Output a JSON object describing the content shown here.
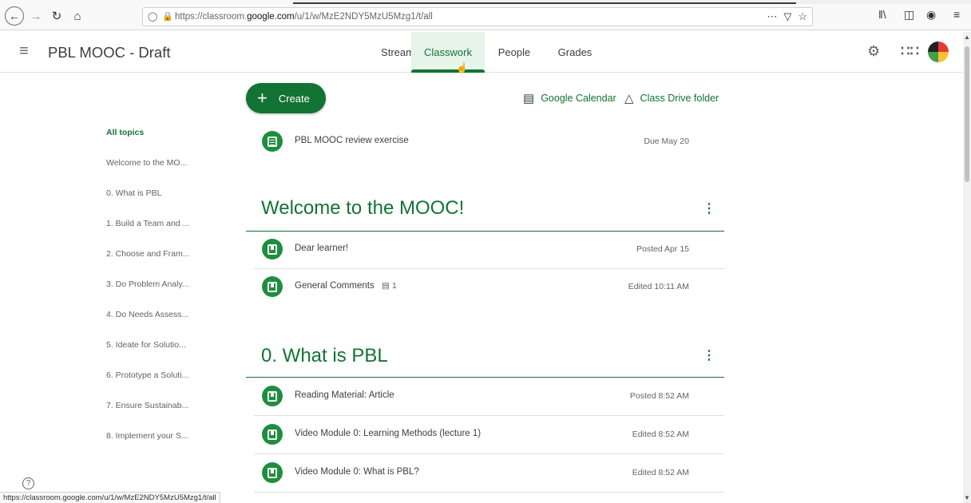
{
  "browser": {
    "url_prefix": "https://classroom.",
    "url_domain": "google.com",
    "url_suffix": "/u/1/w/MzE2NDY5MzU5Mzg1/t/all",
    "status_url": "https://classroom.google.com/u/1/w/MzE2NDY5MzU5Mzg1/t/all"
  },
  "header": {
    "class_title": "PBL MOOC - Draft",
    "tabs": [
      {
        "label": "Stream"
      },
      {
        "label": "Classwork"
      },
      {
        "label": "People"
      },
      {
        "label": "Grades"
      }
    ],
    "active_tab": "Classwork"
  },
  "toolbar": {
    "create_label": "Create",
    "calendar_label": "Google Calendar",
    "drive_label": "Class Drive folder"
  },
  "topics": [
    "All topics",
    "Welcome to the MO...",
    "0. What is PBL",
    "1. Build a Team and ...",
    "2. Choose and Fram...",
    "3. Do Problem Analy...",
    "4. Do Needs Assess...",
    "5. Ideate for Solutio...",
    "6. Prototype a Soluti...",
    "7. Ensure Sustainab...",
    "8. Implement your S..."
  ],
  "top_item": {
    "title": "PBL MOOC review exercise",
    "meta": "Due May 20"
  },
  "sections": [
    {
      "title": "Welcome to the MOOC!",
      "items": [
        {
          "title": "Dear learner!",
          "meta": "Posted Apr 15"
        },
        {
          "title": "General Comments",
          "comments": "1",
          "meta": "Edited 10:11 AM"
        }
      ]
    },
    {
      "title": "0. What is PBL",
      "items": [
        {
          "title": "Reading Material: Article",
          "meta": "Posted 8:52 AM"
        },
        {
          "title": "Video Module 0: Learning Methods (lecture 1)",
          "meta": "Edited 8:52 AM"
        },
        {
          "title": "Video Module 0: What is PBL?",
          "meta": "Edited 8:52 AM"
        }
      ]
    }
  ],
  "colors": {
    "accent": "#137333",
    "icon_green": "#1e8e3e",
    "active_tab_bg": "#e6f4ea"
  },
  "icons": [
    "menu-icon",
    "gear-icon",
    "apps-grid-icon",
    "calendar-icon",
    "drive-icon",
    "help-icon",
    "comment-icon"
  ]
}
